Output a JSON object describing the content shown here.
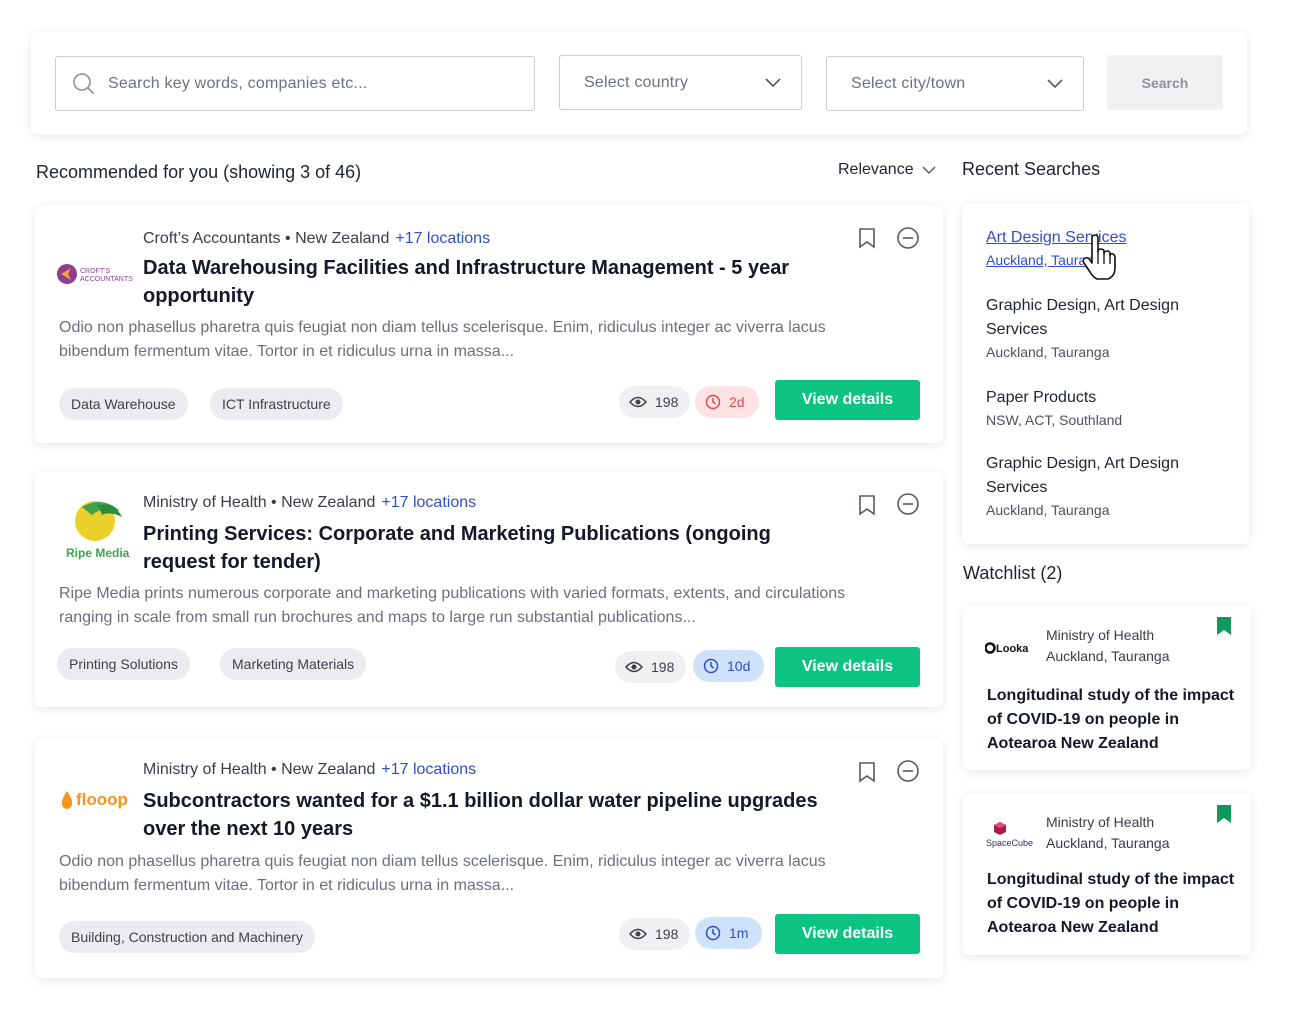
{
  "search": {
    "keyword_placeholder": "Search key words, companies etc...",
    "country_placeholder": "Select country",
    "city_placeholder": "Select city/town",
    "button_label": "Search"
  },
  "results_heading": "Recommended for you (showing 3 of 46)",
  "sort_label": "Relevance",
  "listings": [
    {
      "logo": "Croft's Accountants logo",
      "logo_text": "CROFT'S ACCOUNTANTS",
      "org": "Croft’s Accountants",
      "country": "New Zealand",
      "locations": "+17 locations",
      "title": "Data Warehousing Facilities and Infrastructure Management - 5 year opportunity",
      "description": "Odio non phasellus pharetra quis feugiat non diam tellus scelerisque. Enim, ridiculus integer ac viverra lacus bibendum fermentum vitae. Tortor in et ridiculus urna in massa...",
      "tags": [
        "Data Warehouse",
        "ICT Infrastructure"
      ],
      "views": "198",
      "time_left": "2d",
      "time_status": "urgent",
      "cta": "View details"
    },
    {
      "logo": "Ripe Media logo",
      "logo_text": "Ripe Media",
      "org": "Ministry of Health",
      "country": "New Zealand",
      "locations": "+17 locations",
      "title": "Printing Services: Corporate and Marketing Publications (ongoing request for tender)",
      "description": "Ripe Media prints numerous corporate and marketing publications with varied formats, extents, and circulations ranging in scale from small run brochures and maps to large run substantial publications...",
      "tags": [
        "Printing Solutions",
        "Marketing Materials"
      ],
      "views": "198",
      "time_left": "10d",
      "time_status": "normal",
      "cta": "View details"
    },
    {
      "logo": "flooop logo",
      "logo_text": "flooop",
      "org": "Ministry of Health",
      "country": "New Zealand",
      "locations": "+17 locations",
      "title": "Subcontractors wanted for a $1.1 billion dollar water pipeline upgrades over the next 10 years",
      "description": "Odio non phasellus pharetra quis feugiat non diam tellus scelerisque. Enim, ridiculus integer ac viverra lacus bibendum fermentum vitae. Tortor in et ridiculus urna in massa...",
      "tags": [
        "Building, Construction and Machinery"
      ],
      "views": "198",
      "time_left": "1m",
      "time_status": "normal",
      "cta": "View details"
    }
  ],
  "recent_searches": {
    "heading": "Recent Searches",
    "items": [
      {
        "title": "Art Design Services",
        "locations": "Auckland, Tauranga"
      },
      {
        "title": "Graphic Design, Art Design Services",
        "locations": "Auckland, Tauranga"
      },
      {
        "title": "Paper Products",
        "locations": "NSW, ACT, Southland"
      },
      {
        "title": "Graphic Design, Art Design Services",
        "locations": "Auckland, Tauranga"
      }
    ]
  },
  "watchlist": {
    "heading": "Watchlist (2)",
    "items": [
      {
        "logo": "Looka logo",
        "logo_text": "Looka",
        "org": "Ministry of Health",
        "locations": "Auckland, Tauranga",
        "title": "Longitudinal study of the impact of COVID-19 on people in Aotearoa  New Zealand"
      },
      {
        "logo": "SpaceCube logo",
        "logo_text": "SpaceCube",
        "org": "Ministry of Health",
        "locations": "Auckland, Tauranga",
        "title": "Longitudinal study of the impact of COVID-19 on people in Aotearoa  New Zealand"
      }
    ]
  },
  "colors": {
    "accent_green": "#0cc382",
    "link_blue": "#2f4ec7",
    "urgent_bg": "#fde3e3",
    "urgent_fg": "#e5484d",
    "normal_bg": "#cfe2fb",
    "normal_fg": "#2f4ec7"
  }
}
